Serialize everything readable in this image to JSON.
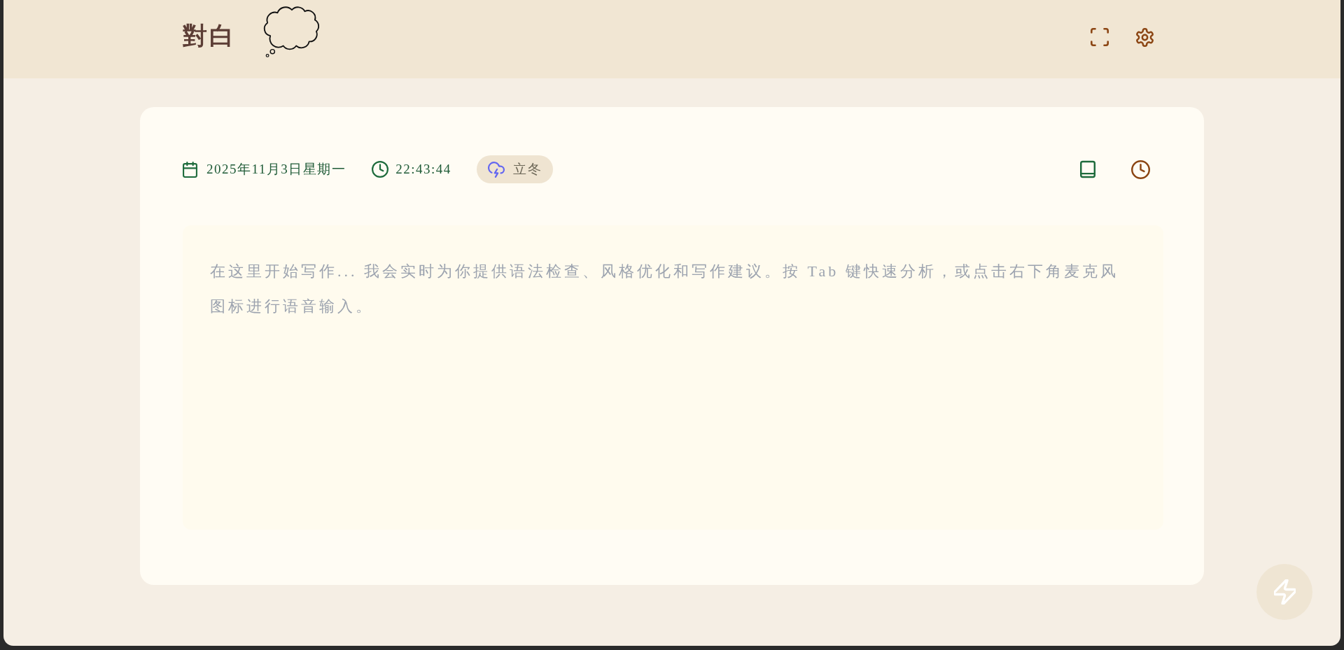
{
  "header": {
    "title": "對白"
  },
  "meta": {
    "date": "2025年11月3日星期一",
    "time": "22:43:44",
    "solar_term": "立冬"
  },
  "editor": {
    "placeholder": "在这里开始写作... 我会实时为你提供语法检查、风格优化和写作建议。按 Tab 键快速分析，或点击右下角麦克风图标进行语音输入。"
  }
}
